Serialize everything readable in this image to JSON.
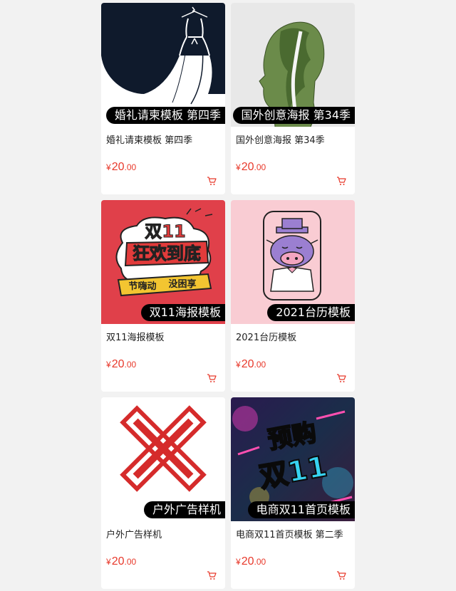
{
  "products": [
    {
      "label": "婚礼请柬模板 第四季",
      "title": "婚礼请柬模板 第四季",
      "currency": "¥",
      "price_int": "20",
      "price_dec": ".00",
      "thumb": "wedding-dress"
    },
    {
      "label": "国外创意海报 第34季",
      "title": "国外创意海报 第34季",
      "currency": "¥",
      "price_int": "20",
      "price_dec": ".00",
      "thumb": "double-exposure-head"
    },
    {
      "label": "双11海报模板",
      "title": "双11海报模板",
      "currency": "¥",
      "price_int": "20",
      "price_dec": ".00",
      "thumb": "double-11-poster",
      "art_text": [
        "双11",
        "狂欢到底",
        "节嗨动",
        "没困享"
      ]
    },
    {
      "label": "2021台历模板",
      "title": "2021台历模板",
      "currency": "¥",
      "price_int": "20",
      "price_dec": ".00",
      "thumb": "ox-calendar"
    },
    {
      "label": "户外广告样机",
      "title": "户外广告样机",
      "currency": "¥",
      "price_int": "20",
      "price_dec": ".00",
      "thumb": "red-x-mark"
    },
    {
      "label": "电商双11首页模板",
      "title": "电商双11首页模板 第二季",
      "currency": "¥",
      "price_int": "20",
      "price_dec": ".00",
      "thumb": "neon-double-11",
      "art_text": [
        "预购",
        "双11"
      ]
    }
  ],
  "colors": {
    "price": "#e8392b",
    "page_bg": "#f2f2f2",
    "label_bg": "#000000"
  },
  "icons": {
    "cart": "shopping-cart-icon"
  }
}
